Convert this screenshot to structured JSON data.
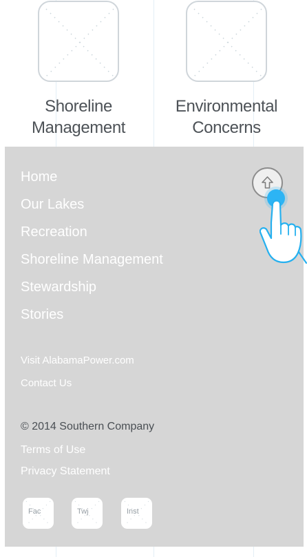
{
  "top_section": {
    "cards": [
      {
        "label_line1": "Shoreline",
        "label_line2": "Management"
      },
      {
        "label_line1": "Environmental",
        "label_line2": "Concerns"
      }
    ]
  },
  "footer": {
    "primary_nav": [
      "Home",
      "Our Lakes",
      "Recreation",
      "Shoreline Management",
      "Stewardship",
      "Stories"
    ],
    "secondary_links": [
      "Visit AlabamaPower.com",
      "Contact Us"
    ],
    "copyright": "© 2014 Southern Company",
    "legal_links": [
      "Terms of Use",
      "Privacy Statement"
    ],
    "social": [
      {
        "label": "Fac",
        "icon": "facebook-icon"
      },
      {
        "label": "Twj",
        "icon": "twitter-icon"
      },
      {
        "label": "Inst",
        "icon": "instagram-icon"
      }
    ],
    "back_to_top_icon": "arrow-up-icon"
  },
  "colors": {
    "footer_bg": "#d6d6d6",
    "link_text": "#ffffff",
    "touch_indicator": "#2db4f4"
  }
}
